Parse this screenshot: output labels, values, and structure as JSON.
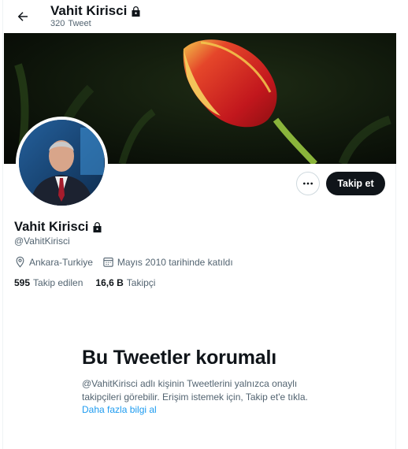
{
  "header": {
    "name": "Vahit Kirisci",
    "tweet_count": "320",
    "tweet_label": "Tweet"
  },
  "profile": {
    "name": "Vahit Kirisci",
    "handle": "@VahitKirisci",
    "location": "Ankara-Turkiye",
    "joined": "Mayıs 2010 tarihinde katıldı",
    "following_count": "595",
    "following_label": "Takip edilen",
    "followers_count": "16,6 B",
    "followers_label": "Takipçi"
  },
  "actions": {
    "follow_label": "Takip et"
  },
  "protected": {
    "title": "Bu Tweetler korumalı",
    "text": "@VahitKirisci adlı kişinin Tweetlerini yalnızca onaylı takipçileri görebilir. Erişim istemek için, Takip et'e tıkla.",
    "link": "Daha fazla bilgi al"
  },
  "icons": {
    "back": "arrow-left-icon",
    "lock": "lock-icon",
    "more": "more-icon",
    "location": "location-pin-icon",
    "calendar": "calendar-icon"
  },
  "colors": {
    "text": "#0f1419",
    "secondary": "#536471",
    "link": "#1d9bf0",
    "button_bg": "#0f1419"
  }
}
